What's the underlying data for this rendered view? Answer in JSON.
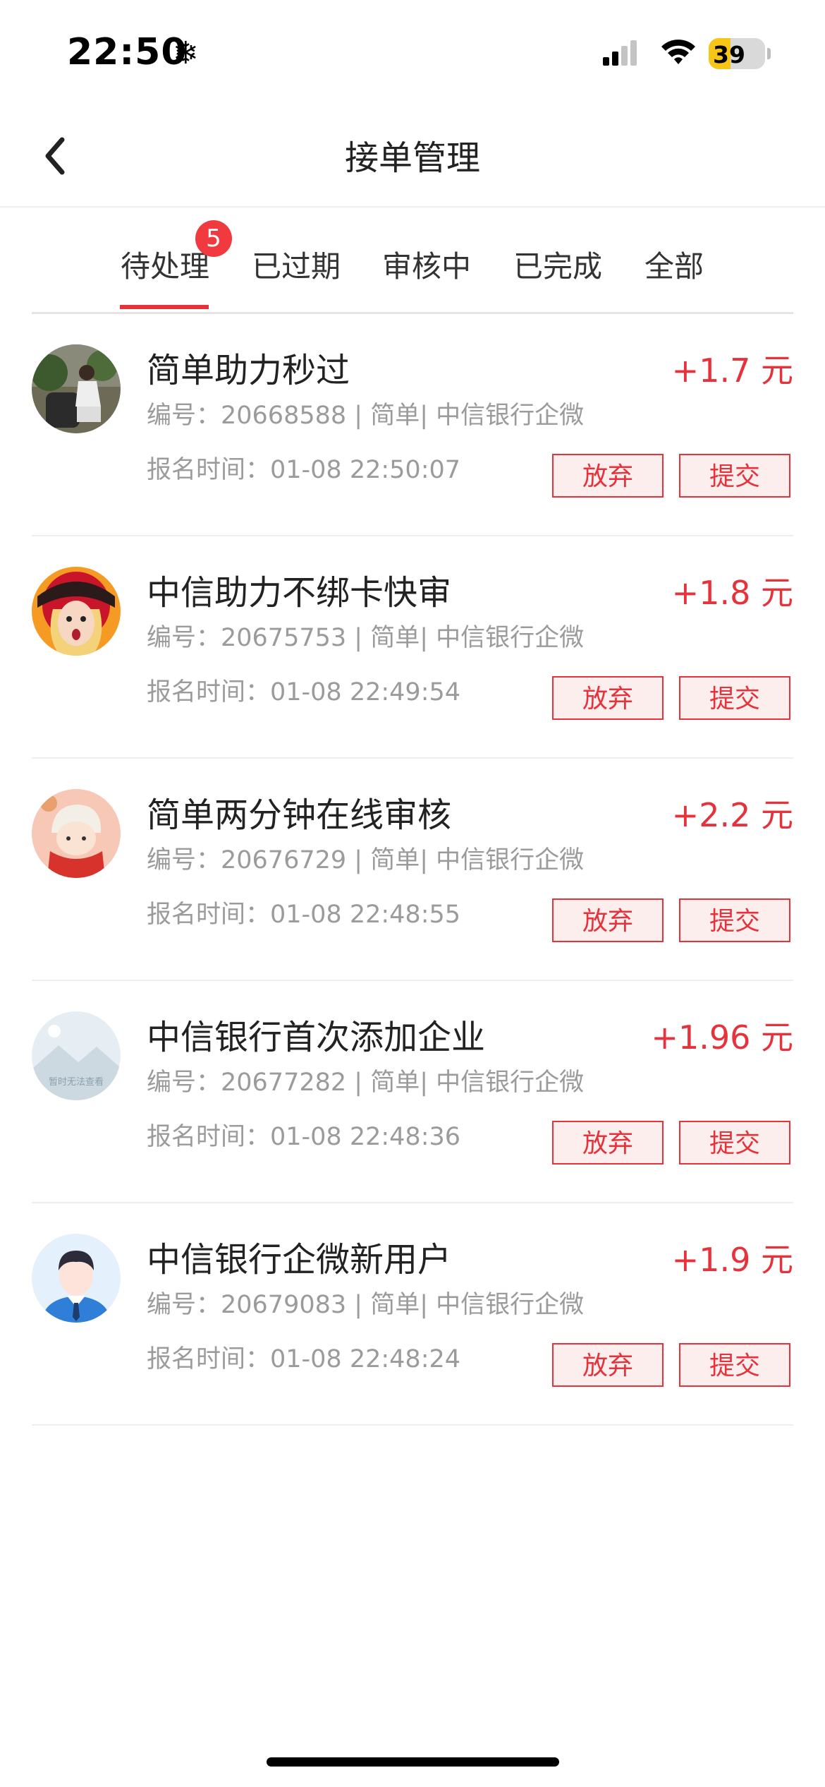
{
  "status_bar": {
    "time": "22:50",
    "battery_level": "39"
  },
  "header": {
    "title": "接单管理"
  },
  "tabs": {
    "items": [
      {
        "label": "待处理"
      },
      {
        "label": "已过期"
      },
      {
        "label": "审核中"
      },
      {
        "label": "已完成"
      },
      {
        "label": "全部"
      }
    ],
    "active_index": 0,
    "badge_count": "5"
  },
  "orders": [
    {
      "title": "简单助力秒过",
      "price": "+1.7 元",
      "meta": "编号：20668588 | 简单| 中信银行企微",
      "time": "报名时间：01-08 22:50:07",
      "abandon_label": "放弃",
      "submit_label": "提交"
    },
    {
      "title": "中信助力不绑卡快审",
      "price": "+1.8 元",
      "meta": "编号：20675753 | 简单| 中信银行企微",
      "time": "报名时间：01-08 22:49:54",
      "abandon_label": "放弃",
      "submit_label": "提交"
    },
    {
      "title": "简单两分钟在线审核",
      "price": "+2.2 元",
      "meta": "编号：20676729 | 简单| 中信银行企微",
      "time": "报名时间：01-08 22:48:55",
      "abandon_label": "放弃",
      "submit_label": "提交"
    },
    {
      "title": "中信银行首次添加企业",
      "price": "+1.96 元",
      "meta": "编号：20677282 | 简单| 中信银行企微",
      "time": "报名时间：01-08 22:48:36",
      "abandon_label": "放弃",
      "submit_label": "提交",
      "avatar_placeholder_text": "暂时无法查看"
    },
    {
      "title": "中信银行企微新用户",
      "price": "+1.9 元",
      "meta": "编号：20679083 | 简单| 中信银行企微",
      "time": "报名时间：01-08 22:48:24",
      "abandon_label": "放弃",
      "submit_label": "提交"
    }
  ],
  "colors": {
    "accent": "#e5323b",
    "button_bg": "#fdeeee",
    "badge": "#f03a40",
    "battery": "#f7c515"
  }
}
